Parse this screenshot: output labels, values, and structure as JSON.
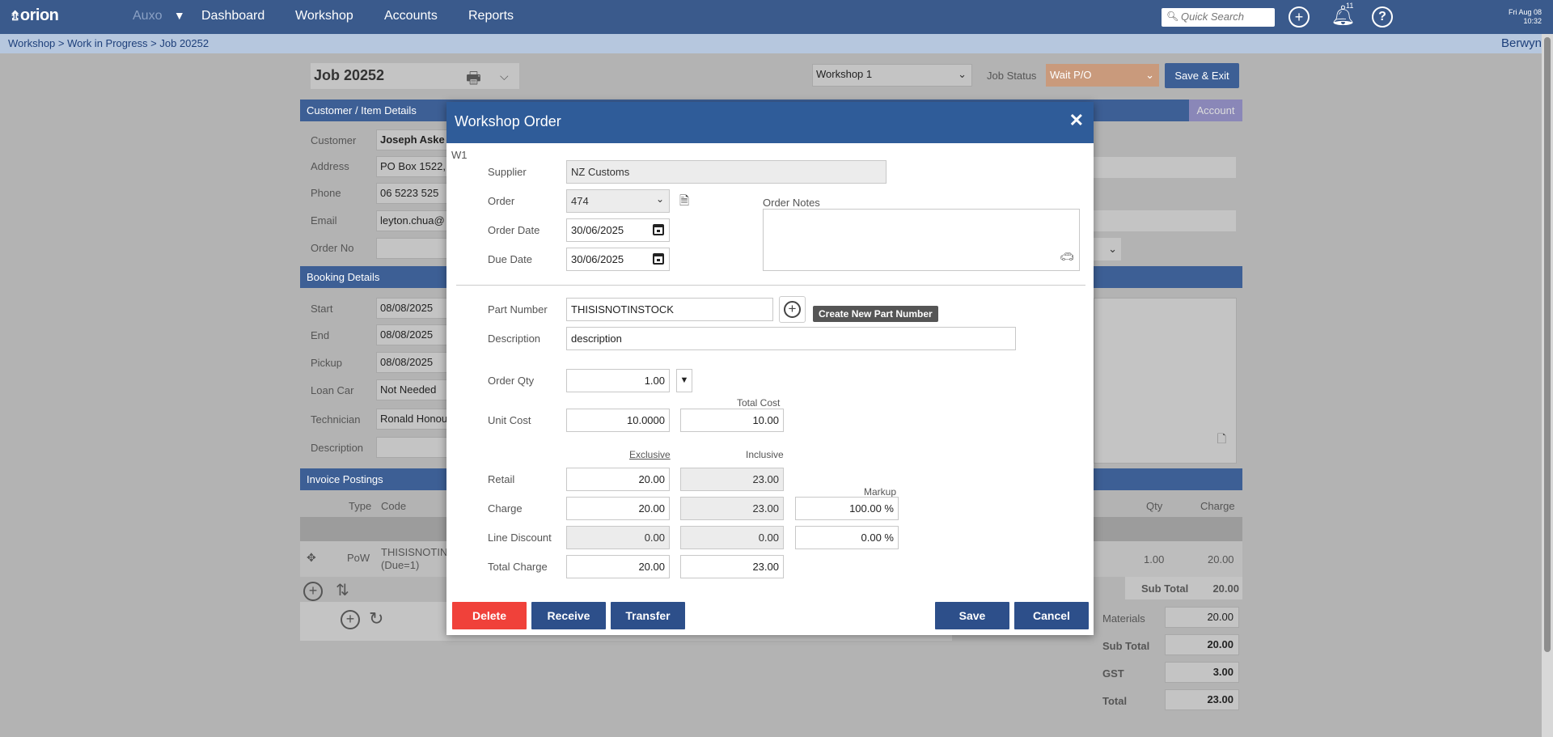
{
  "topbar": {
    "logo": "orion",
    "company": "Auxo",
    "nav": [
      "Dashboard",
      "Workshop",
      "Accounts",
      "Reports"
    ],
    "search_placeholder": "Quick Search",
    "notification_count": "11",
    "date": "Fri Aug 08",
    "time": "10:32"
  },
  "breadcrumb": "Workshop > Work in Progress > Job 20252",
  "user": "Berwyn",
  "job": {
    "title": "Job 20252",
    "workshop": "Workshop 1",
    "status_label": "Job Status",
    "status": "Wait P/O",
    "save_exit": "Save & Exit"
  },
  "customer_panel": {
    "title": "Customer / Item Details",
    "account_tab": "Account",
    "fields": [
      {
        "label": "Customer",
        "value": "Joseph Aske"
      },
      {
        "label": "Address",
        "value": "PO Box 1522,"
      },
      {
        "label": "Phone",
        "value": "06 5223 525"
      },
      {
        "label": "Email",
        "value": "leyton.chua@"
      },
      {
        "label": "Order No",
        "value": ""
      }
    ]
  },
  "booking_panel": {
    "title": "Booking Details",
    "fields": [
      {
        "label": "Start",
        "value": "08/08/2025"
      },
      {
        "label": "End",
        "value": "08/08/2025"
      },
      {
        "label": "Pickup",
        "value": "08/08/2025"
      },
      {
        "label": "Loan Car",
        "value": "Not Needed"
      },
      {
        "label": "Technician",
        "value": "Ronald Honou"
      },
      {
        "label": "Description",
        "value": ""
      }
    ]
  },
  "invoice_panel": {
    "title": "Invoice Postings",
    "col_type": "Type",
    "col_code": "Code",
    "col_qty": "Qty",
    "col_charge": "Charge",
    "row": {
      "type": "PoW",
      "code": "THISISNOTIN",
      "code2": "(Due=1)",
      "qty": "1.00",
      "charge": "20.00"
    },
    "subtotal_label": "Sub Total",
    "subtotal_value": "20.00"
  },
  "totals": [
    {
      "label": "Materials",
      "value": "20.00"
    },
    {
      "label": "Sub Total",
      "value": "20.00"
    },
    {
      "label": "GST",
      "value": "3.00"
    },
    {
      "label": "Total",
      "value": "23.00"
    }
  ],
  "modal": {
    "title": "Workshop Order",
    "tag": "W1",
    "supplier_label": "Supplier",
    "supplier": "NZ Customs",
    "order_label": "Order",
    "order": "474",
    "order_notes_label": "Order Notes",
    "order_date_label": "Order Date",
    "order_date": "30/06/2025",
    "due_date_label": "Due Date",
    "due_date": "30/06/2025",
    "part_number_label": "Part Number",
    "part_number": "THISISNOTINSTOCK",
    "create_part_tooltip": "Create New Part Number",
    "description_label": "Description",
    "description": "description",
    "order_qty_label": "Order Qty",
    "order_qty": "1.00",
    "unit_cost_label": "Unit Cost",
    "unit_cost": "10.0000",
    "total_cost_label": "Total Cost",
    "total_cost": "10.00",
    "exclusive_label": "Exclusive",
    "inclusive_label": "Inclusive",
    "markup_label": "Markup",
    "retail_label": "Retail",
    "retail_ex": "20.00",
    "retail_inc": "23.00",
    "charge_label": "Charge",
    "charge_ex": "20.00",
    "charge_inc": "23.00",
    "markup": "100.00 %",
    "line_discount_label": "Line Discount",
    "discount_ex": "0.00",
    "discount_inc": "0.00",
    "discount_pct": "0.00 %",
    "total_charge_label": "Total Charge",
    "total_ex": "20.00",
    "total_inc": "23.00",
    "buttons": {
      "delete": "Delete",
      "receive": "Receive",
      "transfer": "Transfer",
      "save": "Save",
      "cancel": "Cancel"
    }
  },
  "colors": {
    "nav": "#3a5a8c",
    "modal_header": "#2f5c99",
    "delete": "#f0413a",
    "action": "#2d4f8a"
  }
}
